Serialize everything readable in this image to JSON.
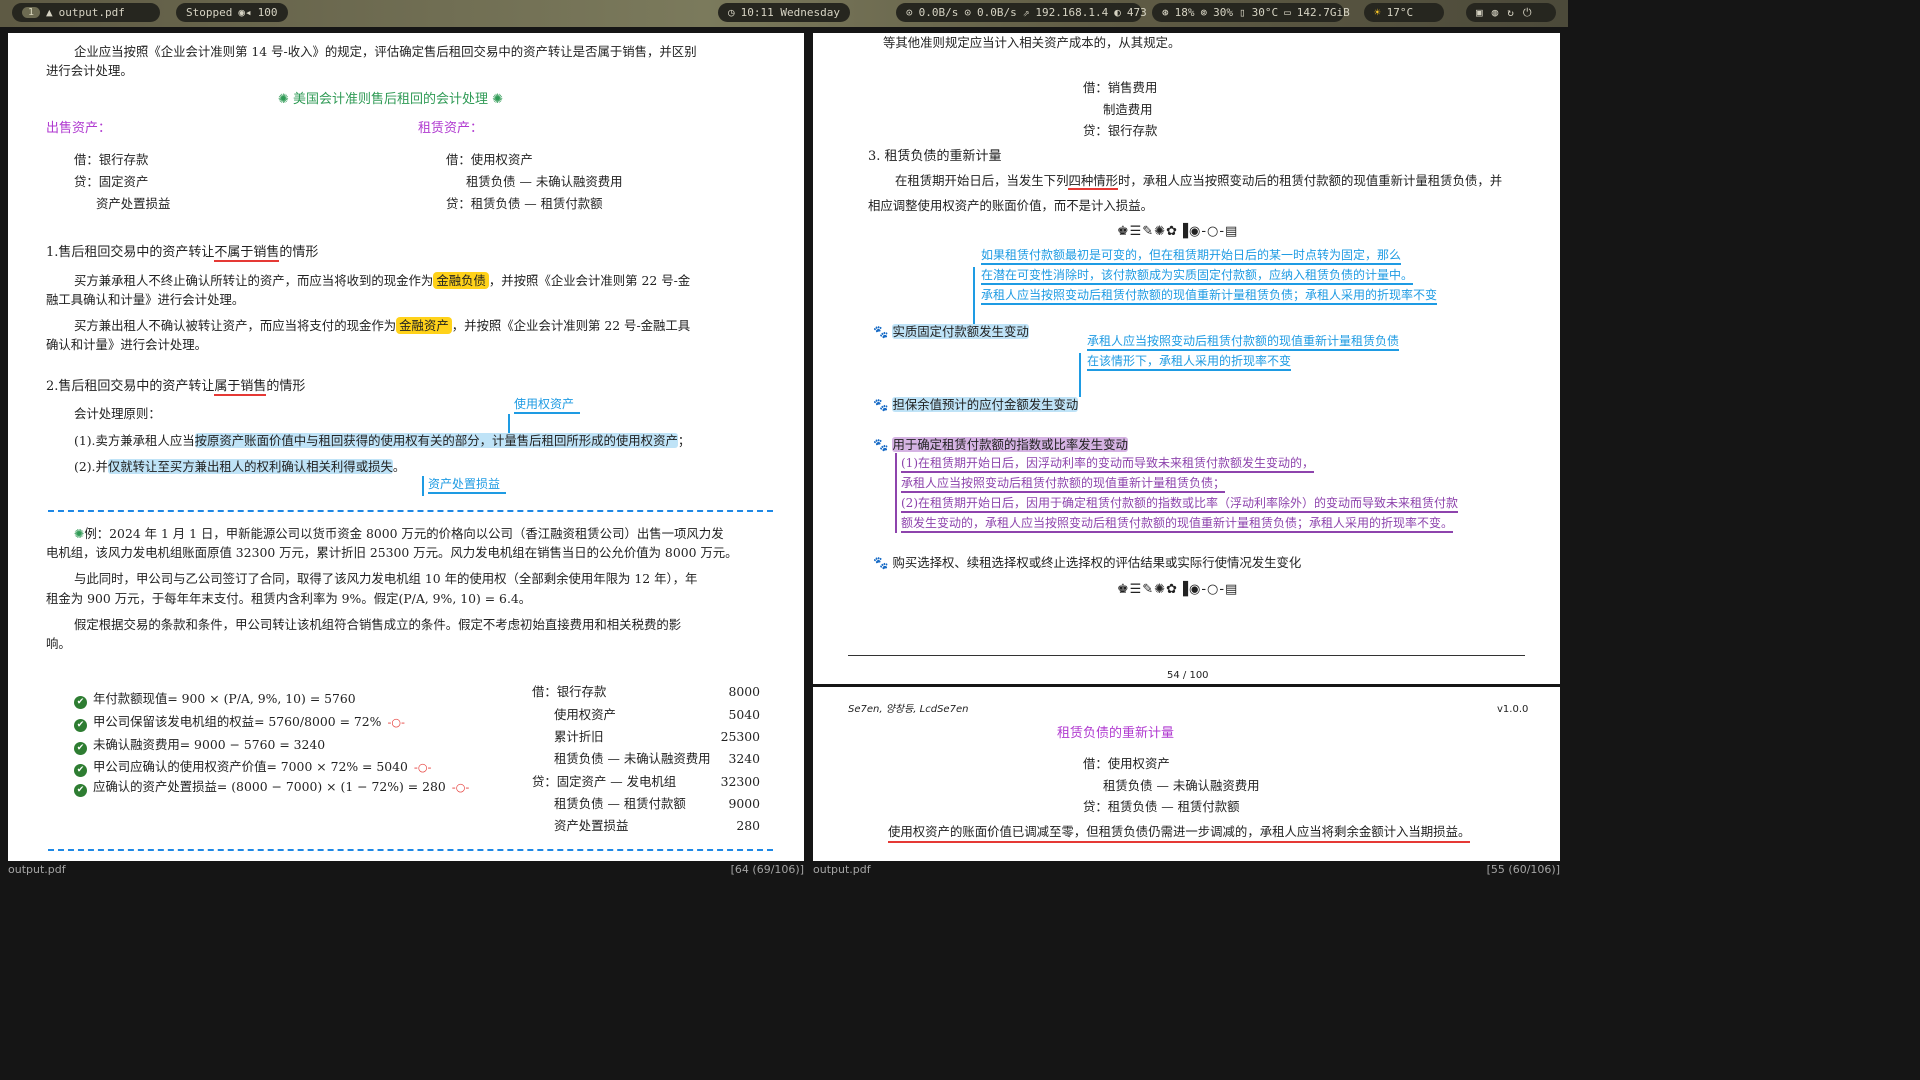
{
  "topbar": {
    "workspace": "1",
    "window_title": "output.pdf",
    "media_status": "Stopped",
    "volume": "100",
    "clock": "10:11 Wednesday",
    "net_down": "0.0B/s",
    "net_up": "0.0B/s",
    "ip": "192.168.1.4",
    "net_extra": "473",
    "cpu": "18%",
    "mem": "30%",
    "temp": "30°C",
    "disk": "142.7GiB",
    "weather": "17°C"
  },
  "left": {
    "p_intro": "企业应当按照《企业会计准则第 14 号-收入》的规定，评估确定售后租回交易中的资产转让是否属于销售，并区别",
    "p_intro2": "进行会计处理。",
    "us_title": "美国会计准则售后租回的会计处理",
    "sale_label": "出售资产：",
    "lease_label": "租赁资产：",
    "sale_entries": [
      "借：银行存款",
      "贷：固定资产",
      "资产处置损益"
    ],
    "lease_entries": [
      "借：使用权资产",
      "租赁负债 — 未确认融资费用",
      "贷：租赁负债 — 租赁付款额"
    ],
    "h1_pre": "1.售后租回交易中的资产转让",
    "h1_ul": "不属于销售",
    "h1_post": "的情形",
    "p1a_pre": "买方兼承租人不终止确认所转让的资产，而应当将收到的现金作为",
    "p1a_hl": "金融负债",
    "p1a_post": "，并按照《企业会计准则第 22 号-金",
    "p1a_2": "融工具确认和计量》进行会计处理。",
    "p1b_pre": "买方兼出租人不确认被转让资产，而应当将支付的现金作为",
    "p1b_hl": "金融资产",
    "p1b_post": "，并按照《企业会计准则第 22 号-金融工具",
    "p1b_2": "确认和计量》进行会计处理。",
    "h2_pre": "2.售后租回交易中的资产转让",
    "h2_ul": "属于销售",
    "h2_post": "的情形",
    "principle": "会计处理原则：",
    "ann_rou": "使用权资产",
    "r1_pre": "(1).卖方兼承租人应当",
    "r1_hl": "按原资产账面价值中与租回获得的使用权有关的部分，计量售后租回所形成的使用权资产",
    "r1_post": "；",
    "r2_pre": "(2).并",
    "r2_hl": "仅就转让至买方兼出租人的权利确认相关利得或损失",
    "r2_post": "。",
    "ann_gain": "资产处置损益",
    "ex1": "例：2024 年 1 月 1 日，甲新能源公司以货币资金 8000 万元的价格向以公司（香江融资租赁公司）出售一项风力发",
    "ex2": "电机组，该风力发电机组账面原值 32300 万元，累计折旧 25300 万元。风力发电机组在销售当日的公允价值为 8000 万元。",
    "ex3": "与此同时，甲公司与乙公司签订了合同，取得了该风力发电机组 10 年的使用权（全部剩余使用年限为 12 年），年",
    "ex4": "租金为 900 万元，于每年年末支付。租赁内含利率为 9%。假定(P/A, 9%, 10) = 6.4。",
    "ex5": "假定根据交易的条款和条件，甲公司转让该机组符合销售成立的条件。假定不考虑初始直接费用和相关税费的影",
    "ex6": "响。",
    "calcs": [
      "年付款额现值= 900 × (P/A, 9%, 10) = 5760",
      "甲公司保留该发电机组的权益= 5760/8000 = 72%",
      "未确认融资费用= 9000 − 5760 = 3240",
      "甲公司应确认的使用权资产价值= 7000 × 72% = 5040",
      "应确认的资产处置损益= (8000 − 7000) × (1 − 72%) = 280"
    ],
    "journal": [
      {
        "acct": "借：银行存款",
        "amt": "8000"
      },
      {
        "acct": "使用权资产",
        "amt": "5040"
      },
      {
        "acct": "累计折旧",
        "amt": "25300"
      },
      {
        "acct": "租赁负债 — 未确认融资费用",
        "amt": "3240"
      },
      {
        "acct": "贷：固定资产 — 发电机组",
        "amt": "32300"
      },
      {
        "acct": "租赁负债 — 租赁付款额",
        "amt": "9000"
      },
      {
        "acct": "资产处置损益",
        "amt": "280"
      }
    ],
    "status_file": "output.pdf",
    "status_page": "[64 (69/106)]"
  },
  "right": {
    "top_line": "等其他准则规定应当计入相关资产成本的，从其规定。",
    "entries_top": [
      "借：销售费用",
      "制造费用",
      "贷：银行存款"
    ],
    "h3": "3. 租赁负债的重新计量",
    "p3_pre": "在租赁期开始日后，当发生下列",
    "p3_ul": "四种情形",
    "p3_post": "时，承租人应当按照变动后的租赁付款额的现值重新计量租赁负债，并",
    "p3_2": "相应调整使用权资产的账面价值，而不是计入损益。",
    "ann_a1": "如果租赁付款额最初是可变的，但在租赁期开始日后的某一时点转为固定，那么",
    "ann_a2": "在潜在可变性消除时，该付款额成为实质固定付款额，应纳入租赁负债的计量中。",
    "ann_a3": "承租人应当按照变动后租赁付款额的现值重新计量租赁负债；承租人采用的折现率不变",
    "case1": "实质固定付款额发生变动",
    "ann_b1": "承租人应当按照变动后租赁付款额的现值重新计量租赁负债",
    "ann_b2": "在该情形下，承租人采用的折现率不变",
    "case2": "担保余值预计的应付金额发生变动",
    "case3": "用于确定租赁付款额的指数或比率发生变动",
    "ann_c1": "(1)在租赁期开始日后，因浮动利率的变动而导致未来租赁付款额发生变动的，",
    "ann_c2": "承租人应当按照变动后租赁付款额的现值重新计量租赁负债；",
    "ann_c3": "(2)在租赁期开始日后，因用于确定租赁付款额的指数或比率（浮动利率除外）的变动而导致未来租赁付款",
    "ann_c4": "额发生变动的，承租人应当按照变动后租赁付款额的现值重新计量租赁负债；承租人采用的折现率不变。",
    "case4": "购买选择权、续租选择权或终止选择权的评估结果或实际行使情况发生变化",
    "page_num": "54 / 100",
    "authors": "Se7en, 양창등, LcdSe7en",
    "version": "v1.0.0",
    "lower_title": "租赁负债的重新计量",
    "lower_entries": [
      "借：使用权资产",
      "租赁负债 — 未确认融资费用",
      "贷：租赁负债 — 租赁付款额"
    ],
    "lower_note": "使用权资产的账面价值已调减至零，但租赁负债仍需进一步调减的，承租人应当将剩余金额计入当期损益。",
    "status_file": "output.pdf",
    "status_page": "[55 (60/106)]"
  }
}
